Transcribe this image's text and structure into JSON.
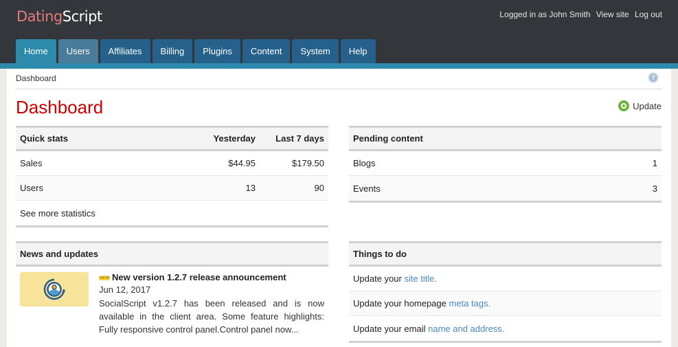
{
  "brand": {
    "part1": "Dating",
    "part2": "Script"
  },
  "userbar": {
    "logged_in": "Logged in as John Smith",
    "view_site": "View site",
    "log_out": "Log out"
  },
  "nav": {
    "tabs": [
      {
        "label": "Home",
        "state": "active"
      },
      {
        "label": "Users",
        "state": "hover"
      },
      {
        "label": "Affiliates"
      },
      {
        "label": "Billing"
      },
      {
        "label": "Plugins"
      },
      {
        "label": "Content"
      },
      {
        "label": "System"
      },
      {
        "label": "Help"
      }
    ]
  },
  "breadcrumb": "Dashboard",
  "help_icon": "?",
  "page_title": "Dashboard",
  "update_label": "Update",
  "quick_stats": {
    "title": "Quick stats",
    "columns": [
      "Yesterday",
      "Last 7 days"
    ],
    "rows": [
      {
        "label": "Sales",
        "yesterday": "$44.95",
        "last7": "$179.50"
      },
      {
        "label": "Users",
        "yesterday": "13",
        "last7": "90"
      }
    ],
    "more_link": "See more statistics"
  },
  "pending": {
    "title": "Pending content",
    "rows": [
      {
        "label": "Blogs",
        "count": "1"
      },
      {
        "label": "Events",
        "count": "3"
      }
    ]
  },
  "news": {
    "title": "News and updates",
    "items": [
      {
        "badge": "NEW",
        "title": "New version 1.2.7 release announcement",
        "date": "Jun 12, 2017",
        "text": "SocialScript v1.2.7 has been released and is now available in the client area. Some feature highlights: Fully responsive control panel.Control panel now..."
      }
    ]
  },
  "todo": {
    "title": "Things to do",
    "items": [
      {
        "prefix": "Update your ",
        "link": "site title",
        "suffix": "."
      },
      {
        "prefix": "Update your homepage ",
        "link": "meta tags",
        "suffix": "."
      },
      {
        "prefix": "Update your email ",
        "link": "name and address",
        "suffix": "."
      }
    ]
  }
}
